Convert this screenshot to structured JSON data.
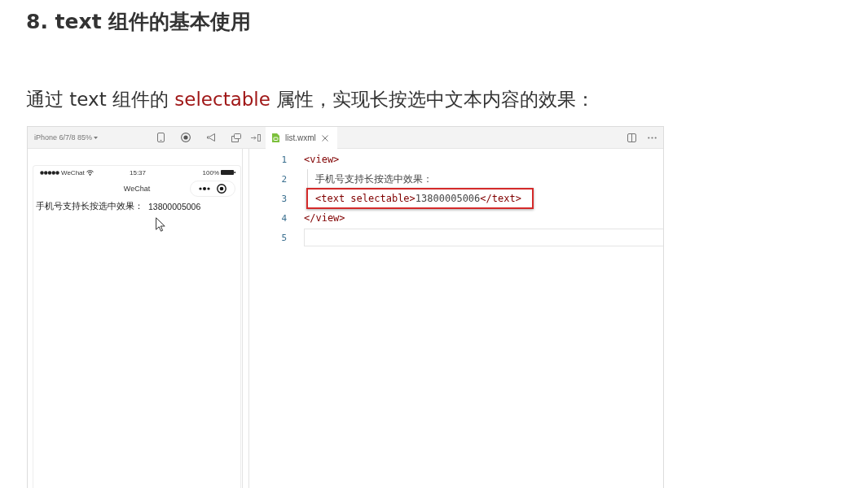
{
  "heading": "8. text 组件的基本使用",
  "intro": {
    "segments": [
      {
        "kind": "plain",
        "text": "通过 text 组件的 "
      },
      {
        "kind": "keyword",
        "text": "selectable"
      },
      {
        "kind": "plain",
        "text": " 属性，实现长按选中文本内容的效果："
      }
    ]
  },
  "simulator": {
    "device": "iPhone 6/7/8 85%",
    "status_bar": {
      "carrier": "WeChat",
      "time": "15:37",
      "battery": "100%"
    },
    "nav_title": "WeChat",
    "content": {
      "label": "手机号支持长按选中效果：",
      "value": "13800005006"
    }
  },
  "editor": {
    "tabs": [
      {
        "label": "list.wxml",
        "selected": true
      }
    ],
    "lines": [
      {
        "number": "1",
        "indented": false,
        "highlighted": false,
        "current": false,
        "tokens": [
          {
            "kind": "tag",
            "text": "<view>"
          }
        ]
      },
      {
        "number": "2",
        "indented": true,
        "highlighted": false,
        "current": false,
        "tokens": [
          {
            "kind": "text",
            "text": "手机号支持长按选中效果："
          }
        ]
      },
      {
        "number": "3",
        "indented": true,
        "highlighted": true,
        "current": false,
        "tokens": [
          {
            "kind": "tag",
            "text": "<text selectable>"
          },
          {
            "kind": "text",
            "text": "13800005006"
          },
          {
            "kind": "tag",
            "text": "</text>"
          }
        ]
      },
      {
        "number": "4",
        "indented": false,
        "highlighted": false,
        "current": false,
        "tokens": [
          {
            "kind": "tag",
            "text": "</view>"
          }
        ]
      },
      {
        "number": "5",
        "indented": false,
        "highlighted": false,
        "current": true
      }
    ]
  }
}
